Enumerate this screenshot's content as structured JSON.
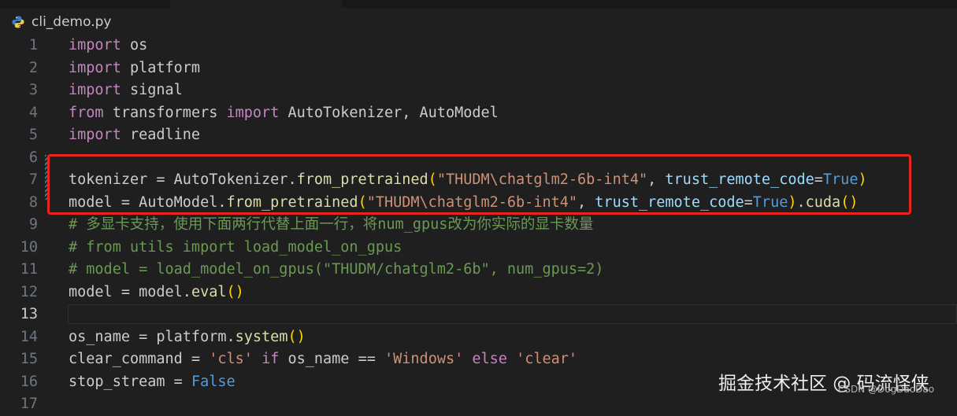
{
  "tab": {
    "filename": "cli_demo.py",
    "icon": "python-file-icon"
  },
  "colors": {
    "background": "#1f1f1f",
    "keyword": "#c586c0",
    "function": "#dcdcaa",
    "string": "#ce9178",
    "comment": "#6a9955",
    "boolean": "#569cd6",
    "parameter": "#9cdcfe",
    "highlight_box": "#e8251c"
  },
  "editor": {
    "active_line": 13,
    "lines": [
      {
        "num": "1",
        "tokens": [
          [
            "kw",
            "import"
          ],
          [
            "pl",
            " os"
          ]
        ]
      },
      {
        "num": "2",
        "tokens": [
          [
            "kw",
            "import"
          ],
          [
            "pl",
            " platform"
          ]
        ]
      },
      {
        "num": "3",
        "tokens": [
          [
            "kw",
            "import"
          ],
          [
            "pl",
            " signal"
          ]
        ]
      },
      {
        "num": "4",
        "tokens": [
          [
            "kw",
            "from"
          ],
          [
            "pl",
            " transformers "
          ],
          [
            "kw",
            "import"
          ],
          [
            "pl",
            " AutoTokenizer, AutoModel"
          ]
        ]
      },
      {
        "num": "5",
        "tokens": [
          [
            "kw",
            "import"
          ],
          [
            "pl",
            " readline"
          ]
        ]
      },
      {
        "num": "6",
        "tokens": []
      },
      {
        "num": "7",
        "tokens": [
          [
            "pl",
            "tokenizer = AutoTokenizer."
          ],
          [
            "fn",
            "from_pretrained"
          ],
          [
            "br1",
            "("
          ],
          [
            "st",
            "\"THUDM\\chatglm2-6b-int4\""
          ],
          [
            "pl",
            ", "
          ],
          [
            "pa",
            "trust_remote_code"
          ],
          [
            "pl",
            "="
          ],
          [
            "bl",
            "True"
          ],
          [
            "br1",
            ")"
          ]
        ]
      },
      {
        "num": "8",
        "tokens": [
          [
            "pl",
            "model = AutoModel."
          ],
          [
            "fn",
            "from_pretrained"
          ],
          [
            "br1",
            "("
          ],
          [
            "st",
            "\"THUDM\\chatglm2-6b-int4\""
          ],
          [
            "pl",
            ", "
          ],
          [
            "pa",
            "trust_remote_code"
          ],
          [
            "pl",
            "="
          ],
          [
            "bl",
            "True"
          ],
          [
            "br1",
            ")"
          ],
          [
            "pl",
            "."
          ],
          [
            "fn",
            "cuda"
          ],
          [
            "br1",
            "()"
          ]
        ]
      },
      {
        "num": "9",
        "tokens": [
          [
            "cm",
            "# 多显卡支持，使用下面两行代替上面一行，将num_gpus改为你实际的显卡数量"
          ]
        ]
      },
      {
        "num": "10",
        "tokens": [
          [
            "cm",
            "# from utils import load_model_on_gpus"
          ]
        ]
      },
      {
        "num": "11",
        "tokens": [
          [
            "cm",
            "# model = load_model_on_gpus(\"THUDM/chatglm2-6b\", num_gpus=2)"
          ]
        ]
      },
      {
        "num": "12",
        "tokens": [
          [
            "pl",
            "model = model."
          ],
          [
            "fn",
            "eval"
          ],
          [
            "br1",
            "()"
          ]
        ]
      },
      {
        "num": "13",
        "tokens": []
      },
      {
        "num": "14",
        "tokens": [
          [
            "pl",
            "os_name = platform."
          ],
          [
            "fn",
            "system"
          ],
          [
            "br1",
            "()"
          ]
        ]
      },
      {
        "num": "15",
        "tokens": [
          [
            "pl",
            "clear_command = "
          ],
          [
            "st",
            "'cls'"
          ],
          [
            "pl",
            " "
          ],
          [
            "kw",
            "if"
          ],
          [
            "pl",
            " os_name == "
          ],
          [
            "st",
            "'Windows'"
          ],
          [
            "pl",
            " "
          ],
          [
            "kw",
            "else"
          ],
          [
            "pl",
            " "
          ],
          [
            "st",
            "'clear'"
          ]
        ]
      },
      {
        "num": "16",
        "tokens": [
          [
            "pl",
            "stop_stream = "
          ],
          [
            "bl",
            "False"
          ]
        ]
      },
      {
        "num": "17",
        "tokens": []
      }
    ]
  },
  "watermark": {
    "main": "掘金技术社区 @ 码流怪侠",
    "sub": "CSDN @DogDaoDao"
  }
}
